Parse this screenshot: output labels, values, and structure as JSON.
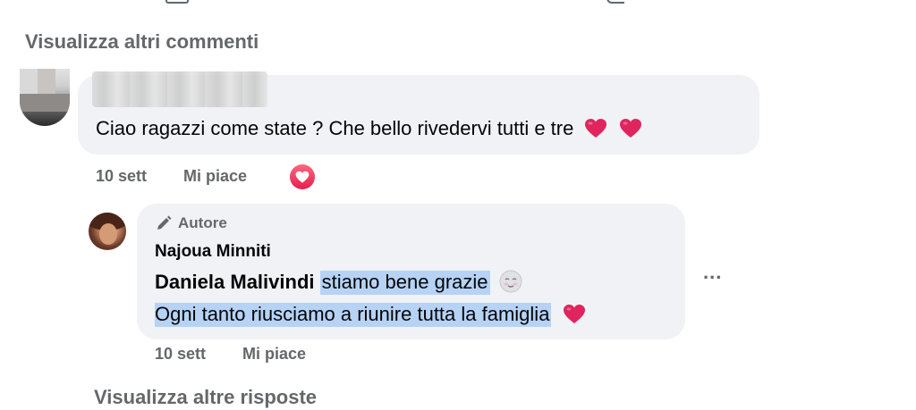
{
  "view_more_comments": "Visualizza altri commenti",
  "comment": {
    "text": "Ciao ragazzi come state ? Che bello rivedervi tutti e tre",
    "time": "10 sett",
    "like_label": "Mi piace",
    "reaction_icon": "heart-reaction-icon"
  },
  "reply": {
    "badge": "Autore",
    "badge_icon": "pencil-icon",
    "author_name": "Najoua Minniti",
    "mention": "Daniela Malivindi",
    "line1_text": "stiamo bene grazie",
    "line2_text": "Ogni tanto riusciamo a riunire tutta la famiglia",
    "time": "10 sett",
    "like_label": "Mi piace",
    "more_options": "..."
  },
  "view_more_replies": "Visualizza altre risposte",
  "colors": {
    "bubble": "#f0f2f5",
    "secondary_text": "#65676b",
    "selection": "#b6d3f5",
    "heart": "#e61e4d"
  }
}
